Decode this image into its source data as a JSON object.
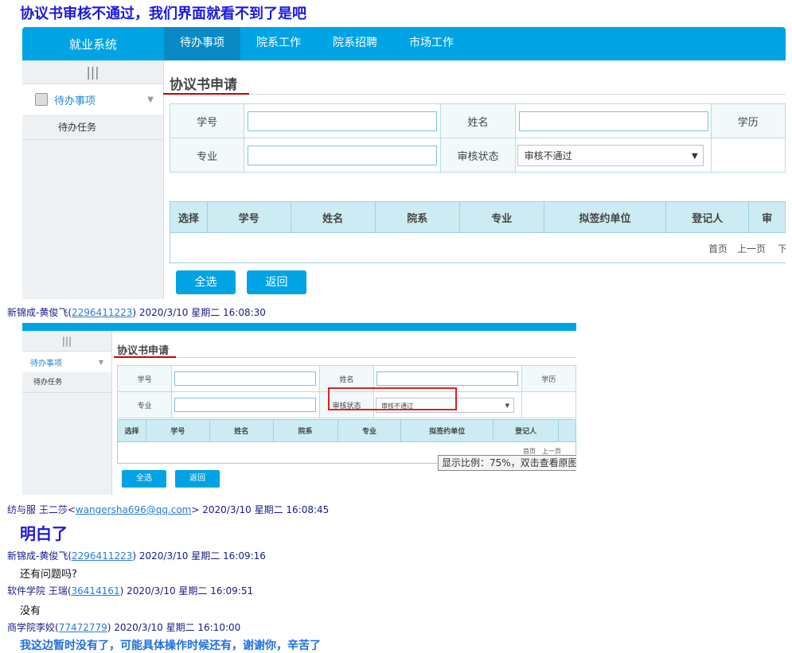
{
  "messages": {
    "m1_text": "协议书审核不通过，我们界面就看不到了是吧",
    "m2_sender": "新锦成-黄俊飞(",
    "m2_qq": "2296411223",
    "m2_time": ") 2020/3/10 星期二 16:08:30",
    "m3_sender": "纺与服 王二莎<",
    "m3_email": "wangersha696@qq.com",
    "m3_time": "> 2020/3/10 星期二 16:08:45",
    "m3_text": "明白了",
    "m4_sender": "新锦成-黄俊飞(",
    "m4_qq": "2296411223",
    "m4_time": ") 2020/3/10 星期二 16:09:16",
    "m4_text": "还有问题吗?",
    "m5_sender": "软件学院 王瑞(",
    "m5_qq": "36414161",
    "m5_time": ") 2020/3/10 星期二 16:09:51",
    "m5_text": "没有",
    "m6_sender": "商学院李姣(",
    "m6_qq": "77472779",
    "m6_time": ") 2020/3/10 星期二 16:10:00",
    "m6_text": "我这边暂时没有了，可能具体操作时候还有，谢谢你，辛苦了"
  },
  "app": {
    "brand": "就业系统",
    "nav": [
      "待办事项",
      "院系工作",
      "院系招聘",
      "市场工作"
    ],
    "grip": "|||",
    "menu_label": "待办事项",
    "submenu_label": "待办任务",
    "page_title": "协议书申请",
    "labels": {
      "student_id": "学号",
      "name": "姓名",
      "degree": "学历",
      "major": "专业",
      "review_status": "审核状态"
    },
    "review_status_value": "审核不通过",
    "columns": [
      "选择",
      "学号",
      "姓名",
      "院系",
      "专业",
      "拟签约单位",
      "登记人",
      "审"
    ],
    "pager": {
      "first": "首页",
      "prev": "上一页",
      "next": "下"
    },
    "buttons": {
      "select_all": "全选",
      "back": "返回"
    }
  },
  "screenshot2": {
    "page_title": "协议书申请",
    "columns": [
      "选择",
      "学号",
      "姓名",
      "院系",
      "专业",
      "拟签约单位",
      "登记人"
    ],
    "pager": "首页　上一页",
    "tooltip": "显示比例：75%，双击查看原图"
  }
}
